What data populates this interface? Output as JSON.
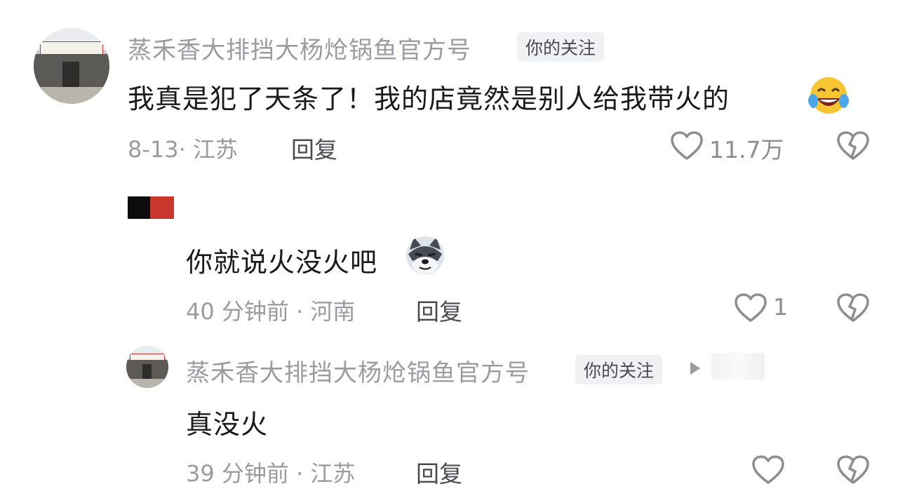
{
  "comments": [
    {
      "author": "蒸禾香大排挡大杨炝锅鱼官方号",
      "badge": "你的关注",
      "text": "我真是犯了天条了！我的店竟然是别人给我带火的",
      "emoji": "laughing-tears-emoji",
      "meta": "8-13· 江苏",
      "reply_label": "回复",
      "like_count": "11.7万"
    },
    {
      "text": "你就说火没火吧",
      "emoji": "husky-dog-emoji",
      "meta": "40 分钟前 · 河南",
      "reply_label": "回复",
      "like_count": "1"
    },
    {
      "author": "蒸禾香大排挡大杨炝锅鱼官方号",
      "badge": "你的关注",
      "text": "真没火",
      "meta": "39 分钟前 · 江苏",
      "reply_label": "回复",
      "like_count": ""
    }
  ],
  "icons": {
    "like": "heart-outline-icon",
    "dislike": "broken-heart-icon",
    "reply_arrow": "triangle-right-icon"
  },
  "colors": {
    "name_gray": "#9b9ca1",
    "text_dark": "#1a1a1c",
    "badge_bg": "#f0f1f3"
  }
}
